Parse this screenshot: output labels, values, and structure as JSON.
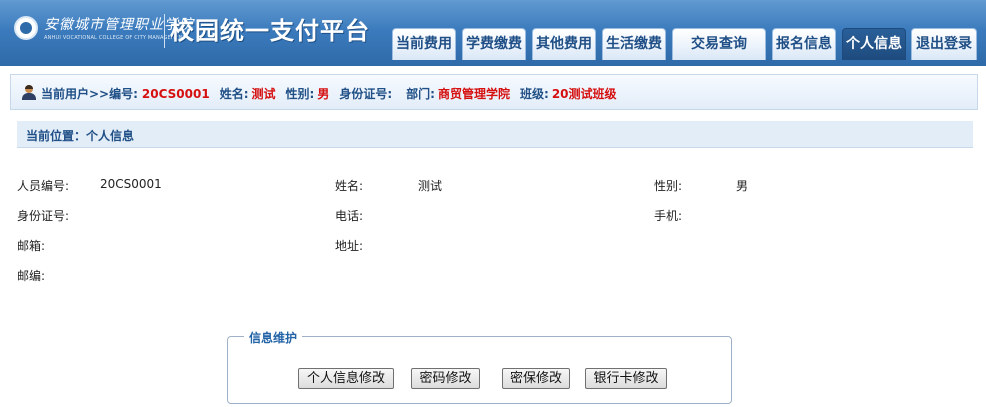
{
  "header": {
    "school_name_cn": "安徽城市管理职业学院",
    "school_name_en": "ANHUI VOCATIONAL COLLEGE OF CITY MANAGEMENT",
    "platform_title": "校园统一支付平台"
  },
  "nav": {
    "tabs": [
      {
        "label": "当前费用",
        "active": false
      },
      {
        "label": "学费缴费",
        "active": false
      },
      {
        "label": "其他费用",
        "active": false
      },
      {
        "label": "生活缴费",
        "active": false
      },
      {
        "label": "交易查询",
        "active": false
      },
      {
        "label": "报名信息",
        "active": false
      },
      {
        "label": "个人信息",
        "active": true
      },
      {
        "label": "退出登录",
        "active": false
      }
    ]
  },
  "userbar": {
    "current_user_label": "当前用户>>编号:",
    "id_value": "20CS0001",
    "name_label": "姓名:",
    "name_value": "测试",
    "gender_label": "性别:",
    "gender_value": "男",
    "idcard_label": "身份证号:",
    "idcard_value": "",
    "dept_label": "部门:",
    "dept_value": "商贸管理学院",
    "class_label": "班级:",
    "class_value": "20测试班级"
  },
  "position": {
    "text": "当前位置：个人信息"
  },
  "info": {
    "staff_id_label": "人员编号:",
    "staff_id_value": "20CS0001",
    "name_label": "姓名:",
    "name_value": "测试",
    "gender_label": "性别:",
    "gender_value": "男",
    "idcard_label": "身份证号:",
    "idcard_value": "",
    "phone_label": "电话:",
    "phone_value": "",
    "mobile_label": "手机:",
    "mobile_value": "",
    "email_label": "邮箱:",
    "email_value": "",
    "address_label": "地址:",
    "address_value": "",
    "postcode_label": "邮编:",
    "postcode_value": ""
  },
  "maintenance": {
    "legend": "信息维护",
    "buttons": {
      "edit_info": "个人信息修改",
      "change_password": "密码修改",
      "change_security": "密保修改",
      "change_bankcard": "银行卡修改"
    }
  },
  "colors": {
    "header_blue": "#3b7bbd",
    "nav_text": "#1f4f86",
    "highlight_red": "#d60f0f",
    "bar_bg": "#e3edf8"
  }
}
